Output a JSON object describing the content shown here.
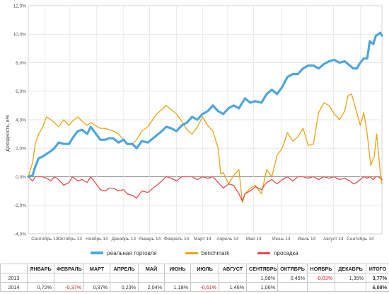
{
  "chart_data": {
    "type": "line",
    "ylabel": "Доходность, в%",
    "ylim": [
      -4,
      12
    ],
    "yticks": [
      "-4,0%",
      "-2,0%",
      "0,0%",
      "2,0%",
      "4,0%",
      "6,0%",
      "8,0%",
      "10,0%",
      "12,0%"
    ],
    "xrange": [
      "2013-08-14",
      "2014-09-26"
    ],
    "x_ticks": [
      {
        "label": "Сентябрь 13",
        "date": "2013-09-02"
      },
      {
        "label": "Октябрь 13",
        "date": "2013-10-01"
      },
      {
        "label": "Ноябрь 13",
        "date": "2013-11-01"
      },
      {
        "label": "Декабрь 13",
        "date": "2013-12-02"
      },
      {
        "label": "Январь 14",
        "date": "2014-01-01"
      },
      {
        "label": "Февраль 14",
        "date": "2014-02-01"
      },
      {
        "label": "Март 14",
        "date": "2014-03-03"
      },
      {
        "label": "Апрель 14",
        "date": "2014-04-01"
      },
      {
        "label": "Май 14",
        "date": "2014-05-01"
      },
      {
        "label": "Июнь 14",
        "date": "2014-06-02"
      },
      {
        "label": "Июль 14",
        "date": "2014-07-01"
      },
      {
        "label": "Август 14",
        "date": "2014-08-01"
      },
      {
        "label": "Сентябрь 14",
        "date": "2014-09-01"
      }
    ],
    "grid": true,
    "legend_position": "bottom",
    "series": [
      {
        "name": "реальная торговля",
        "color": "#4ea6dc",
        "points": [
          [
            "2013-08-14",
            0.0
          ],
          [
            "2013-08-19",
            0.1
          ],
          [
            "2013-08-22",
            0.7
          ],
          [
            "2013-08-26",
            1.3
          ],
          [
            "2013-08-30",
            1.4
          ],
          [
            "2013-09-04",
            1.6
          ],
          [
            "2013-09-09",
            1.8
          ],
          [
            "2013-09-13",
            2.0
          ],
          [
            "2013-09-18",
            2.4
          ],
          [
            "2013-09-24",
            2.3
          ],
          [
            "2013-09-30",
            2.3
          ],
          [
            "2013-10-04",
            2.7
          ],
          [
            "2013-10-10",
            3.2
          ],
          [
            "2013-10-15",
            3.3
          ],
          [
            "2013-10-21",
            3.0
          ],
          [
            "2013-10-25",
            3.5
          ],
          [
            "2013-10-30",
            3.1
          ],
          [
            "2013-11-05",
            2.6
          ],
          [
            "2013-11-11",
            2.6
          ],
          [
            "2013-11-15",
            2.7
          ],
          [
            "2013-11-20",
            2.7
          ],
          [
            "2013-11-26",
            2.4
          ],
          [
            "2013-12-02",
            2.6
          ],
          [
            "2013-12-06",
            2.3
          ],
          [
            "2013-12-12",
            2.3
          ],
          [
            "2013-12-17",
            2.0
          ],
          [
            "2013-12-23",
            2.5
          ],
          [
            "2013-12-30",
            2.4
          ],
          [
            "2014-01-09",
            2.9
          ],
          [
            "2014-01-15",
            3.2
          ],
          [
            "2014-01-20",
            3.5
          ],
          [
            "2014-01-26",
            3.4
          ],
          [
            "2014-02-01",
            3.2
          ],
          [
            "2014-02-07",
            3.6
          ],
          [
            "2014-02-13",
            3.8
          ],
          [
            "2014-02-19",
            4.2
          ],
          [
            "2014-02-25",
            4.0
          ],
          [
            "2014-03-03",
            4.4
          ],
          [
            "2014-03-09",
            4.6
          ],
          [
            "2014-03-15",
            5.0
          ],
          [
            "2014-03-21",
            4.6
          ],
          [
            "2014-03-27",
            4.4
          ],
          [
            "2014-04-02",
            4.8
          ],
          [
            "2014-04-08",
            5.0
          ],
          [
            "2014-04-14",
            4.8
          ],
          [
            "2014-04-21",
            5.5
          ],
          [
            "2014-04-27",
            5.2
          ],
          [
            "2014-05-03",
            5.3
          ],
          [
            "2014-05-10",
            5.2
          ],
          [
            "2014-05-16",
            5.8
          ],
          [
            "2014-05-22",
            6.1
          ],
          [
            "2014-05-28",
            5.8
          ],
          [
            "2014-06-03",
            6.3
          ],
          [
            "2014-06-09",
            7.0
          ],
          [
            "2014-06-15",
            7.2
          ],
          [
            "2014-06-21",
            7.2
          ],
          [
            "2014-06-27",
            7.6
          ],
          [
            "2014-07-03",
            7.8
          ],
          [
            "2014-07-09",
            7.8
          ],
          [
            "2014-07-15",
            7.6
          ],
          [
            "2014-07-21",
            7.9
          ],
          [
            "2014-07-27",
            8.1
          ],
          [
            "2014-08-02",
            8.2
          ],
          [
            "2014-08-08",
            8.0
          ],
          [
            "2014-08-14",
            8.1
          ],
          [
            "2014-08-20",
            7.8
          ],
          [
            "2014-08-24",
            7.6
          ],
          [
            "2014-08-28",
            7.6
          ],
          [
            "2014-09-01",
            8.0
          ],
          [
            "2014-09-05",
            8.3
          ],
          [
            "2014-09-09",
            8.3
          ],
          [
            "2014-09-12",
            9.5
          ],
          [
            "2014-09-16",
            9.3
          ],
          [
            "2014-09-19",
            9.9
          ],
          [
            "2014-09-22",
            10.0
          ],
          [
            "2014-09-24",
            10.1
          ],
          [
            "2014-09-26",
            9.9
          ]
        ]
      },
      {
        "name": "benchmark",
        "color": "#e8a413",
        "points": [
          [
            "2013-08-14",
            0.0
          ],
          [
            "2013-08-19",
            1.0
          ],
          [
            "2013-08-22",
            2.3
          ],
          [
            "2013-08-26",
            3.0
          ],
          [
            "2013-08-30",
            3.4
          ],
          [
            "2013-09-04",
            4.2
          ],
          [
            "2013-09-09",
            4.0
          ],
          [
            "2013-09-13",
            3.8
          ],
          [
            "2013-09-18",
            3.5
          ],
          [
            "2013-09-24",
            4.0
          ],
          [
            "2013-09-30",
            3.6
          ],
          [
            "2013-10-04",
            3.9
          ],
          [
            "2013-10-10",
            4.2
          ],
          [
            "2013-10-15",
            3.9
          ],
          [
            "2013-10-21",
            3.6
          ],
          [
            "2013-10-25",
            3.8
          ],
          [
            "2013-10-30",
            3.6
          ],
          [
            "2013-11-05",
            3.4
          ],
          [
            "2013-11-11",
            3.4
          ],
          [
            "2013-11-15",
            3.3
          ],
          [
            "2013-11-20",
            3.2
          ],
          [
            "2013-11-26",
            3.0
          ],
          [
            "2013-12-02",
            2.6
          ],
          [
            "2013-12-06",
            2.3
          ],
          [
            "2013-12-12",
            2.3
          ],
          [
            "2013-12-17",
            2.6
          ],
          [
            "2013-12-23",
            3.2
          ],
          [
            "2013-12-30",
            3.5
          ],
          [
            "2014-01-09",
            4.4
          ],
          [
            "2014-01-15",
            4.7
          ],
          [
            "2014-01-20",
            5.0
          ],
          [
            "2014-01-26",
            4.7
          ],
          [
            "2014-02-01",
            4.4
          ],
          [
            "2014-02-07",
            3.9
          ],
          [
            "2014-02-13",
            3.3
          ],
          [
            "2014-02-19",
            3.0
          ],
          [
            "2014-02-25",
            3.5
          ],
          [
            "2014-03-03",
            4.2
          ],
          [
            "2014-03-09",
            3.6
          ],
          [
            "2014-03-15",
            3.2
          ],
          [
            "2014-03-21",
            2.0
          ],
          [
            "2014-03-24",
            0.2
          ],
          [
            "2014-03-27",
            0.3
          ],
          [
            "2014-04-02",
            -0.5
          ],
          [
            "2014-04-08",
            0.1
          ],
          [
            "2014-04-14",
            0.5
          ],
          [
            "2014-04-18",
            -1.8
          ],
          [
            "2014-04-21",
            -1.2
          ],
          [
            "2014-04-27",
            -0.8
          ],
          [
            "2014-05-03",
            -0.6
          ],
          [
            "2014-05-10",
            -1.2
          ],
          [
            "2014-05-16",
            0.5
          ],
          [
            "2014-05-22",
            0.0
          ],
          [
            "2014-05-28",
            1.5
          ],
          [
            "2014-06-03",
            2.0
          ],
          [
            "2014-06-09",
            3.1
          ],
          [
            "2014-06-15",
            2.5
          ],
          [
            "2014-06-21",
            2.8
          ],
          [
            "2014-06-27",
            3.4
          ],
          [
            "2014-07-03",
            2.2
          ],
          [
            "2014-07-09",
            2.3
          ],
          [
            "2014-07-15",
            4.5
          ],
          [
            "2014-07-21",
            5.2
          ],
          [
            "2014-07-27",
            5.0
          ],
          [
            "2014-08-02",
            4.4
          ],
          [
            "2014-08-08",
            4.0
          ],
          [
            "2014-08-14",
            4.6
          ],
          [
            "2014-08-18",
            5.7
          ],
          [
            "2014-08-22",
            5.8
          ],
          [
            "2014-08-28",
            4.5
          ],
          [
            "2014-09-01",
            3.6
          ],
          [
            "2014-09-05",
            4.5
          ],
          [
            "2014-09-09",
            3.0
          ],
          [
            "2014-09-13",
            0.8
          ],
          [
            "2014-09-17",
            1.4
          ],
          [
            "2014-09-20",
            3.0
          ],
          [
            "2014-09-24",
            0.4
          ],
          [
            "2014-09-26",
            -0.5
          ]
        ]
      },
      {
        "name": "просадка",
        "color": "#e84a4a",
        "points": [
          [
            "2013-08-14",
            0.0
          ],
          [
            "2013-08-19",
            -0.3
          ],
          [
            "2013-08-22",
            0.0
          ],
          [
            "2013-08-26",
            0.0
          ],
          [
            "2013-08-30",
            0.0
          ],
          [
            "2013-09-04",
            -0.1
          ],
          [
            "2013-09-09",
            -0.3
          ],
          [
            "2013-09-13",
            0.0
          ],
          [
            "2013-09-18",
            -0.2
          ],
          [
            "2013-09-24",
            -0.6
          ],
          [
            "2013-09-30",
            -0.4
          ],
          [
            "2013-10-04",
            0.0
          ],
          [
            "2013-10-10",
            -0.3
          ],
          [
            "2013-10-15",
            -0.2
          ],
          [
            "2013-10-21",
            -0.4
          ],
          [
            "2013-10-25",
            0.0
          ],
          [
            "2013-10-30",
            -0.4
          ],
          [
            "2013-11-05",
            -0.9
          ],
          [
            "2013-11-11",
            -1.0
          ],
          [
            "2013-11-15",
            -0.8
          ],
          [
            "2013-11-20",
            -0.8
          ],
          [
            "2013-11-26",
            -1.0
          ],
          [
            "2013-12-02",
            -0.9
          ],
          [
            "2013-12-06",
            -1.2
          ],
          [
            "2013-12-12",
            -1.3
          ],
          [
            "2013-12-17",
            -1.5
          ],
          [
            "2013-12-23",
            -1.0
          ],
          [
            "2013-12-30",
            -1.1
          ],
          [
            "2014-01-09",
            -0.6
          ],
          [
            "2014-01-15",
            -0.3
          ],
          [
            "2014-01-20",
            0.0
          ],
          [
            "2014-01-26",
            -0.1
          ],
          [
            "2014-02-01",
            -0.3
          ],
          [
            "2014-02-07",
            0.0
          ],
          [
            "2014-02-13",
            0.0
          ],
          [
            "2014-02-19",
            0.0
          ],
          [
            "2014-02-25",
            -0.2
          ],
          [
            "2014-03-03",
            0.0
          ],
          [
            "2014-03-09",
            -0.1
          ],
          [
            "2014-03-15",
            0.0
          ],
          [
            "2014-03-21",
            -0.4
          ],
          [
            "2014-03-24",
            -0.6
          ],
          [
            "2014-03-27",
            -0.8
          ],
          [
            "2014-04-02",
            -0.5
          ],
          [
            "2014-04-08",
            -0.6
          ],
          [
            "2014-04-14",
            -1.2
          ],
          [
            "2014-04-18",
            -1.7
          ],
          [
            "2014-04-21",
            -1.2
          ],
          [
            "2014-04-27",
            -1.0
          ],
          [
            "2014-05-03",
            -0.7
          ],
          [
            "2014-05-10",
            -0.9
          ],
          [
            "2014-05-16",
            -0.4
          ],
          [
            "2014-05-22",
            -0.2
          ],
          [
            "2014-05-28",
            -0.5
          ],
          [
            "2014-06-03",
            -0.2
          ],
          [
            "2014-06-09",
            0.0
          ],
          [
            "2014-06-15",
            -0.3
          ],
          [
            "2014-06-21",
            0.0
          ],
          [
            "2014-06-27",
            0.0
          ],
          [
            "2014-07-03",
            -0.1
          ],
          [
            "2014-07-09",
            0.0
          ],
          [
            "2014-07-15",
            -0.2
          ],
          [
            "2014-07-21",
            0.0
          ],
          [
            "2014-07-27",
            -0.1
          ],
          [
            "2014-08-02",
            0.0
          ],
          [
            "2014-08-08",
            -0.2
          ],
          [
            "2014-08-14",
            -0.1
          ],
          [
            "2014-08-20",
            -0.3
          ],
          [
            "2014-08-24",
            -0.5
          ],
          [
            "2014-08-28",
            -0.4
          ],
          [
            "2014-09-01",
            -0.2
          ],
          [
            "2014-09-05",
            0.0
          ],
          [
            "2014-09-09",
            -0.1
          ],
          [
            "2014-09-12",
            0.0
          ],
          [
            "2014-09-16",
            -0.2
          ],
          [
            "2014-09-19",
            0.0
          ],
          [
            "2014-09-22",
            0.0
          ],
          [
            "2014-09-24",
            -0.1
          ],
          [
            "2014-09-26",
            -0.2
          ]
        ]
      }
    ]
  },
  "table": {
    "headers": [
      "",
      "ЯНВАРЬ",
      "ФЕВРАЛЬ",
      "МАРТ",
      "АПРЕЛЬ",
      "МАЙ",
      "ИЮНЬ",
      "ИЮЛЬ",
      "АВГУСТ",
      "СЕНТЯБРЬ",
      "ОКТЯБРЬ",
      "НОЯБРЬ",
      "ДЕКАБРЬ",
      "ИТОГО"
    ],
    "rows": [
      [
        "2013",
        "",
        "",
        "",
        "",
        "",
        "",
        "",
        "",
        "1,98%",
        "0,45%",
        "-0,03%",
        "1,35%",
        "3,77%"
      ],
      [
        "2014",
        "0,72%",
        "-0,37%",
        "0,37%",
        "0,23%",
        "2,04%",
        "1,18%",
        "-0,61%",
        "1,46%",
        "1,06%",
        "",
        "",
        "",
        "6,08%"
      ]
    ]
  }
}
